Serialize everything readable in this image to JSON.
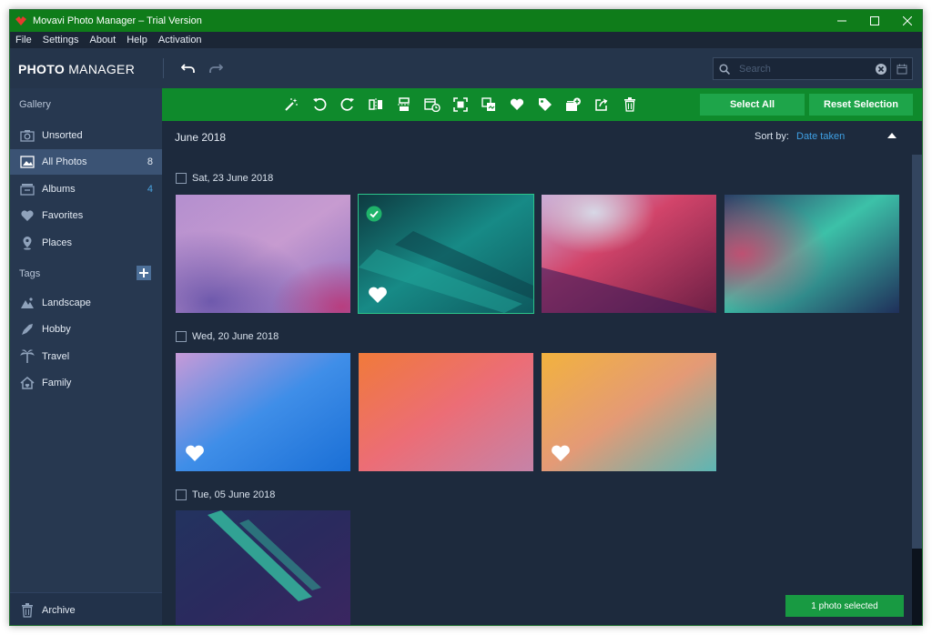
{
  "window": {
    "title": "Movavi Photo Manager – Trial Version"
  },
  "menu": [
    "File",
    "Settings",
    "About",
    "Help",
    "Activation"
  ],
  "header": {
    "logo_bold": "PHOTO",
    "logo_light": " MANAGER",
    "search_placeholder": "Search"
  },
  "sidebar": {
    "gallery_heading": "Gallery",
    "items": [
      {
        "label": "Unsorted",
        "count": "",
        "icon": "unsorted-icon"
      },
      {
        "label": "All Photos",
        "count": "8",
        "icon": "photos-icon"
      },
      {
        "label": "Albums",
        "count": "4",
        "icon": "albums-icon"
      },
      {
        "label": "Favorites",
        "count": "",
        "icon": "heart-icon"
      },
      {
        "label": "Places",
        "count": "",
        "icon": "place-pin-icon"
      }
    ],
    "tags_heading": "Tags",
    "tags": [
      {
        "label": "Landscape",
        "icon": "landscape-icon"
      },
      {
        "label": "Hobby",
        "icon": "hobby-icon"
      },
      {
        "label": "Travel",
        "icon": "palm-tree-icon"
      },
      {
        "label": "Family",
        "icon": "family-house-icon"
      }
    ],
    "archive_label": "Archive"
  },
  "toolbar": {
    "select_all": "Select All",
    "reset_selection": "Reset Selection",
    "tools": [
      "magic-wand-icon",
      "rotate-left-icon",
      "rotate-right-icon",
      "flip-horizontal-icon",
      "flip-vertical-icon",
      "change-date-icon",
      "crop-icon",
      "duplicates-icon",
      "heart-icon",
      "tag-icon",
      "add-to-album-icon",
      "share-icon",
      "trash-icon"
    ]
  },
  "content": {
    "month": "June 2018",
    "sort_label": "Sort by:",
    "sort_value": "Date taken",
    "groups": [
      {
        "date": "Sat, 23 June 2018"
      },
      {
        "date": "Wed, 20 June 2018"
      },
      {
        "date": "Tue, 05 June 2018"
      }
    ],
    "status": "1 photo selected"
  },
  "colors": {
    "titlebar": "#0f7c1a",
    "toolbar": "#0f8a2c",
    "button": "#1ea54a",
    "sidebar": "#273850",
    "content": "#1d2a3d",
    "accent_link": "#3fa0e4"
  }
}
